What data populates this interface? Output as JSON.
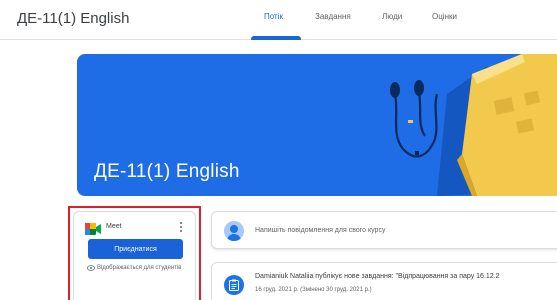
{
  "header": {
    "class_title": "ДЕ-11(1) English",
    "tabs": [
      {
        "label": "Потік",
        "active": true
      },
      {
        "label": "Завдання",
        "active": false
      },
      {
        "label": "Люди",
        "active": false
      },
      {
        "label": "Оцінки",
        "active": false
      }
    ]
  },
  "banner": {
    "title": "ДЕ-11(1) English",
    "color": "#1e6ce6"
  },
  "meet": {
    "label": "Meet",
    "join_label": "Приєднатися",
    "visibility_note": "Відображається для студентів"
  },
  "announce": {
    "placeholder": "Напишіть повідомлення для свого курсу"
  },
  "post": {
    "text": "Damianiuk Nataliia публікує нове завдання: \"Відпрацювання за пару 16.12.2",
    "date": "16 груд. 2021 р. (Змінено 30 груд. 2021 р.)"
  },
  "colors": {
    "accent": "#1967d2",
    "highlight_frame": "#e01e2a"
  }
}
